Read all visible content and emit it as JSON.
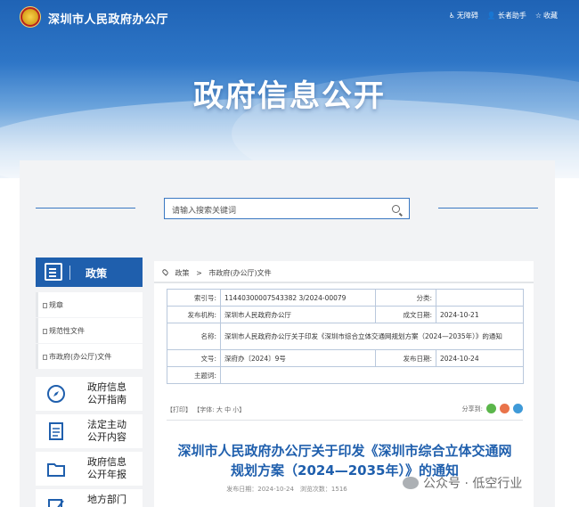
{
  "header": {
    "site_name": "深圳市人民政府办公厅",
    "top_links": [
      {
        "icon": "accessibility-icon",
        "label": "无障碍"
      },
      {
        "icon": "elder-assist-icon",
        "label": "长者助手"
      },
      {
        "icon": "star-icon",
        "label": "收藏"
      }
    ],
    "banner_title": "政府信息公开"
  },
  "search": {
    "placeholder": "请输入搜索关键词"
  },
  "sidebar": {
    "head_label": "政策",
    "sub_items": [
      "规章",
      "规范性文件",
      "市政府(办公厅)文件"
    ],
    "cards": [
      {
        "icon": "compass-icon",
        "label_1": "政府信息",
        "label_2": "公开指南"
      },
      {
        "icon": "document-icon",
        "label_1": "法定主动",
        "label_2": "公开内容"
      },
      {
        "icon": "folder-icon",
        "label_1": "政府信息",
        "label_2": "公开年报"
      },
      {
        "icon": "edit-icon",
        "label_1": "地方部门",
        "label_2": ""
      }
    ]
  },
  "breadcrumb": {
    "items": [
      "政策",
      "市政府(办公厅)文件"
    ],
    "separator": ">"
  },
  "info": {
    "index_label": "索引号:",
    "index_value": "11440300007543382 3/2024-00079",
    "category_label": "分类:",
    "category_value": "",
    "publisher_label": "发布机构:",
    "publisher_value": "深圳市人民政府办公厅",
    "date_label": "成文日期:",
    "date_value": "2024-10-21",
    "name_label": "名称:",
    "name_value": "深圳市人民政府办公厅关于印发《深圳市综合立体交通网规划方案（2024—2035年）》的通知",
    "docno_label": "文号:",
    "docno_value": "深府办〔2024〕9号",
    "pubdate_label": "发布日期:",
    "pubdate_value": "2024-10-24",
    "keywords_label": "主题词:",
    "keywords_value": ""
  },
  "tools": {
    "print": "【打印】",
    "font": "【字体:",
    "large": "大",
    "medium": "中",
    "small": "小",
    "close": "】",
    "share_label": "分享到:"
  },
  "document": {
    "title_line1": "深圳市人民政府办公厅关于印发《深圳市综合立体交通网",
    "title_line2": "规划方案（2024—2035年）》的通知",
    "pub_line": "发布日期：2024-10-24　浏览次数：1516"
  },
  "watermark": "公众号 · 低空行业",
  "colors": {
    "brand_blue": "#1f5fad",
    "border_blue": "#3a78c2",
    "panel_bg": "#f2f3f5"
  }
}
